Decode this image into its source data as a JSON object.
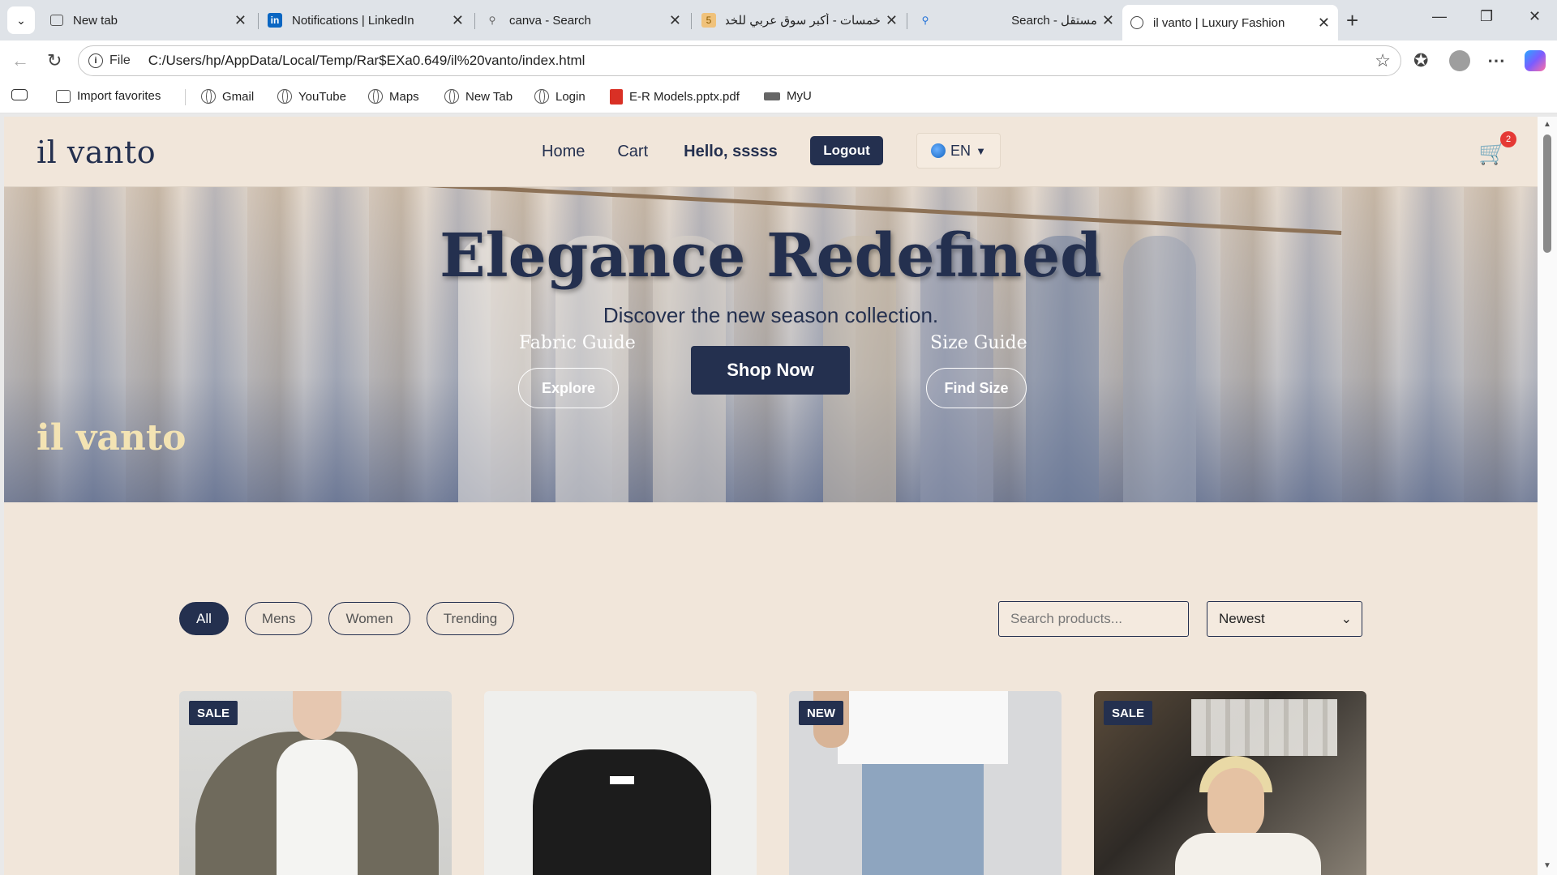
{
  "browser": {
    "tabs": [
      {
        "title": "New tab",
        "icon": "newtab-icon",
        "active": false
      },
      {
        "title": "Notifications | LinkedIn",
        "icon": "linkedin-icon",
        "active": false
      },
      {
        "title": "canva - Search",
        "icon": "search-icon",
        "active": false
      },
      {
        "title": "خمسات - أكبر سوق عربي للخد",
        "icon": "khamsat-icon",
        "active": false
      },
      {
        "title": "Search - مستقل",
        "icon": "search-icon",
        "active": false
      },
      {
        "title": "il vanto | Luxury Fashion",
        "icon": "globe-icon",
        "active": true
      }
    ],
    "address": {
      "scheme_label": "File",
      "url": "C:/Users/hp/AppData/Local/Temp/Rar$EXa0.649/il%20vanto/index.html"
    },
    "bookmarks": [
      {
        "label": "Import favorites",
        "icon": "import-icon"
      },
      {
        "label": "Gmail",
        "icon": "globe-icon"
      },
      {
        "label": "YouTube",
        "icon": "globe-icon"
      },
      {
        "label": "Maps",
        "icon": "globe-icon"
      },
      {
        "label": "New Tab",
        "icon": "globe-icon"
      },
      {
        "label": "Login",
        "icon": "globe-icon"
      },
      {
        "label": "E-R Models.pptx.pdf",
        "icon": "pdf-icon"
      },
      {
        "label": "MyU",
        "icon": "myu-icon"
      }
    ]
  },
  "site": {
    "logo": "il vanto",
    "nav": {
      "home": "Home",
      "cart": "Cart",
      "hello": "Hello, sssss",
      "logout": "Logout"
    },
    "language": "EN",
    "cart_count": "2",
    "hero": {
      "title": "Elegance Redefined",
      "subtitle": "Discover the new season collection.",
      "fabric_guide_title": "Fabric Guide",
      "fabric_guide_button": "Explore",
      "shop_now": "Shop Now",
      "size_guide_title": "Size Guide",
      "size_guide_button": "Find Size",
      "brand_overlay": "il vanto"
    },
    "filters": {
      "chips": [
        "All",
        "Mens",
        "Women",
        "Trending"
      ],
      "active_chip": "All",
      "search_placeholder": "Search products...",
      "sort_selected": "Newest"
    },
    "products": [
      {
        "badge": "SALE",
        "image": "hoodie-image"
      },
      {
        "badge": "",
        "image": "leather-jacket-image"
      },
      {
        "badge": "NEW",
        "image": "jeans-image"
      },
      {
        "badge": "SALE",
        "image": "cafe-woman-image"
      }
    ],
    "colors": {
      "primary": "#24304f",
      "background": "#f1e6da",
      "accent_gold": "#f3e3b3",
      "badge_red": "#e53935"
    }
  }
}
